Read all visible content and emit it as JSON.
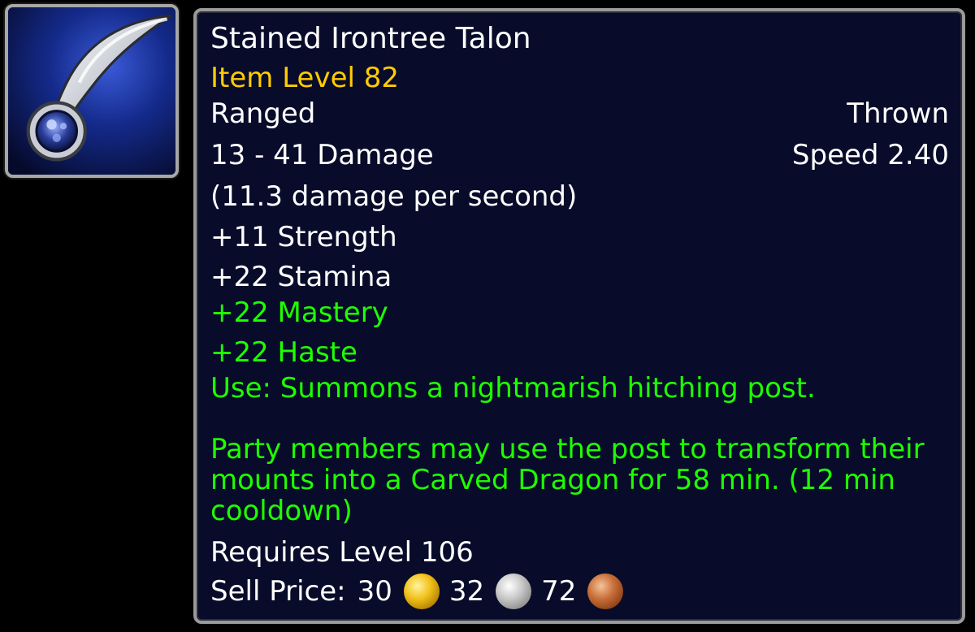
{
  "item": {
    "icon": "throwing-talon-icon",
    "name": "Stained Irontree Talon",
    "item_level": "Item Level 82",
    "slot_left": "Ranged",
    "slot_right": "Thrown",
    "damage": "13 - 41 Damage",
    "speed": "Speed 2.40",
    "dps": "(11.3 damage per second)",
    "stats_white": [
      "+11 Strength",
      "+22 Stamina"
    ],
    "stats_green": [
      "+22 Mastery",
      "+22 Haste"
    ],
    "use": "Use: Summons a nightmarish hitching post.",
    "use_desc": "Party members may use the post to transform their mounts into a Carved Dragon for 58 min. (12 min cooldown)",
    "requires": "Requires Level 106",
    "sell_label": "Sell Price:",
    "sell_gold": "30",
    "sell_silver": "32",
    "sell_copper": "72"
  },
  "colors": {
    "background": "#000000",
    "tooltip_bg": "#080c2a",
    "border": "#9a9a9a",
    "name": "#ffffff",
    "item_level": "#ffcc00",
    "bonus_stat": "#1eff00"
  }
}
